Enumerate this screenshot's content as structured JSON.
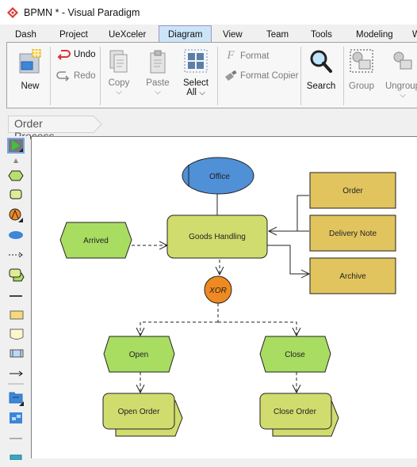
{
  "window": {
    "title": "BPMN * - Visual Paradigm",
    "logo_icon": "visual-paradigm-logo"
  },
  "menu": {
    "tabs": [
      {
        "label": "Dash"
      },
      {
        "label": "Project"
      },
      {
        "label": "UeXceler"
      },
      {
        "label": "Diagram",
        "active": true
      },
      {
        "label": "View"
      },
      {
        "label": "Team"
      },
      {
        "label": "Tools"
      },
      {
        "label": "Modeling"
      },
      {
        "label": "W"
      }
    ]
  },
  "ribbon": {
    "new": "New",
    "undo": "Undo",
    "redo": "Redo",
    "copy": "Copy",
    "paste": "Paste",
    "select_all_1": "Select",
    "select_all_2": "All",
    "format": "Format",
    "format_copier": "Format Copier",
    "search": "Search",
    "group": "Group",
    "ungroup": "Ungroup",
    "chevron": "⌵"
  },
  "breadcrumb": {
    "label": "Order Process"
  },
  "palette": {
    "items": [
      "selector",
      "collapse",
      "event",
      "function",
      "xor-connector",
      "organization-unit",
      "control-flow",
      "process-path",
      "separator",
      "information-object",
      "document",
      "system",
      "information-flow",
      "separator",
      "folder",
      "diagram-overview",
      "separator",
      "more"
    ]
  },
  "diagram": {
    "colors": {
      "event": "#a8dd62",
      "function": "#d1dc6e",
      "org_unit": "#4f90d6",
      "info": "#e2c45e",
      "connector": "#ef8a22"
    },
    "nodes": {
      "office": "Office",
      "goods_handling": "Goods Handling",
      "arrived": "Arrived",
      "order": "Order",
      "delivery_note": "Delivery Note",
      "archive": "Archive",
      "xor": "XOR",
      "open": "Open",
      "close": "Close",
      "open_order": "Open Order",
      "close_order": "Close Order"
    }
  }
}
